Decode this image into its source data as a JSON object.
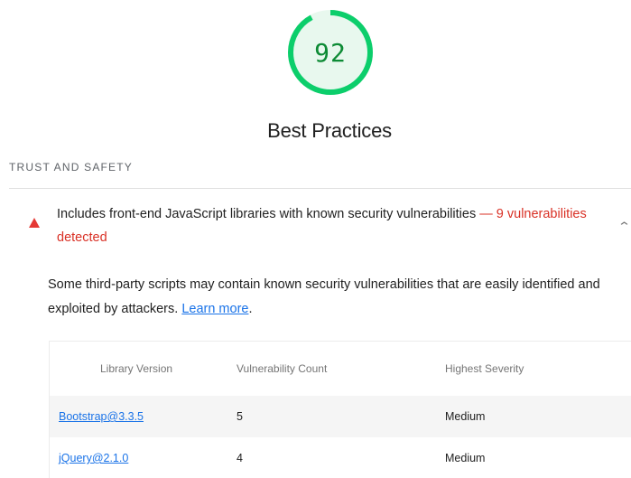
{
  "gauge": {
    "score": "92",
    "fraction": 0.92,
    "ring_color": "#0cce6b",
    "fill_color": "#e8f8ee",
    "text_color": "#0d8b35"
  },
  "category": {
    "title": "Best Practices"
  },
  "group": {
    "title": "Trust and Safety"
  },
  "audit": {
    "title": "Includes front-end JavaScript libraries with known security vulnerabilities",
    "separator": " — ",
    "display_value": "9 vulnerabilities detected",
    "status_icon": "warning-triangle-icon",
    "status_color": "#e53935",
    "expand_icon": "chevron-up-icon",
    "description": "Some third-party scripts may contain known security vulnerabilities that are easily identified and exploited by attackers.",
    "learn_more": "Learn more",
    "table": {
      "headers": [
        "Library Version",
        "Vulnerability Count",
        "Highest Severity"
      ],
      "rows": [
        {
          "library": "Bootstrap@3.3.5",
          "count": "5",
          "severity": "Medium"
        },
        {
          "library": "jQuery@2.1.0",
          "count": "4",
          "severity": "Medium"
        }
      ]
    }
  }
}
